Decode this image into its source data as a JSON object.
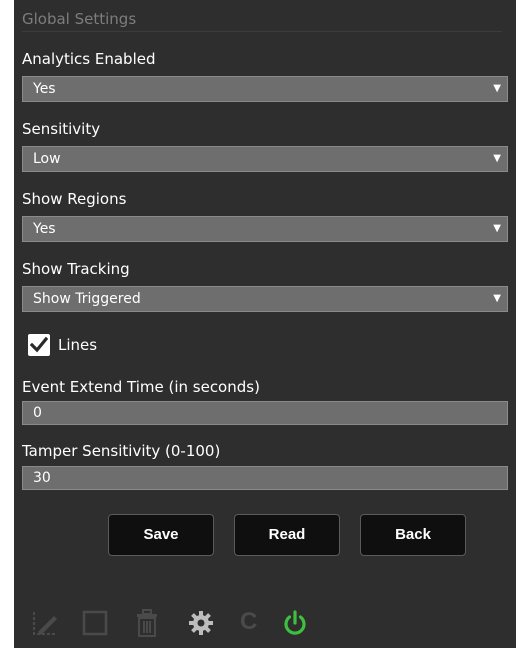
{
  "panel": {
    "title": "Global Settings"
  },
  "fields": {
    "analytics": {
      "label": "Analytics Enabled",
      "value": "Yes"
    },
    "sensitivity": {
      "label": "Sensitivity",
      "value": "Low"
    },
    "show_regions": {
      "label": "Show Regions",
      "value": "Yes"
    },
    "show_tracking": {
      "label": "Show Tracking",
      "value": "Show Triggered"
    },
    "lines": {
      "label": "Lines",
      "checked": true
    },
    "event_extend": {
      "label": "Event Extend Time (in seconds)",
      "value": "0"
    },
    "tamper": {
      "label": "Tamper Sensitivity (0-100)",
      "value": "30"
    }
  },
  "buttons": {
    "save": "Save",
    "read": "Read",
    "back": "Back"
  },
  "toolbar": {
    "icons": [
      "draw-line-icon",
      "rectangle-icon",
      "trash-icon",
      "gear-icon",
      "c-icon",
      "power-icon"
    ],
    "c_label": "C",
    "power_color": "#3fbf3f",
    "disabled_color": "#4a4a4a",
    "gear_color": "#bdbdbd"
  }
}
